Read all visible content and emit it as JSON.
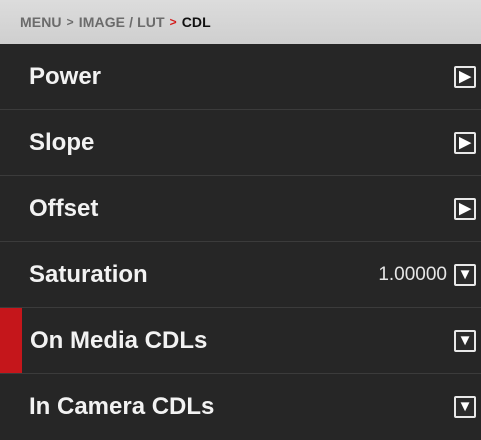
{
  "breadcrumb": {
    "items": [
      "MENU",
      "IMAGE / LUT",
      "CDL"
    ],
    "separator": ">",
    "current_color": "#111111",
    "active_separator_color": "#d31a1a"
  },
  "menu": {
    "items": [
      {
        "label": "Power",
        "value": "",
        "control": "arrow-right",
        "selected": false
      },
      {
        "label": "Slope",
        "value": "",
        "control": "arrow-right",
        "selected": false
      },
      {
        "label": "Offset",
        "value": "",
        "control": "arrow-right",
        "selected": false
      },
      {
        "label": "Saturation",
        "value": "1.00000",
        "control": "chevron-down",
        "selected": false
      },
      {
        "label": "On Media CDLs",
        "value": "",
        "control": "chevron-down",
        "selected": true
      },
      {
        "label": "In Camera CDLs",
        "value": "",
        "control": "chevron-down",
        "selected": false
      }
    ]
  },
  "colors": {
    "background": "#262626",
    "header": "#d6d6d6",
    "selected_accent": "#c5161b",
    "text": "#f2f2f2"
  },
  "icons": {
    "arrow_right": "▶",
    "chevron_down": "▼"
  }
}
